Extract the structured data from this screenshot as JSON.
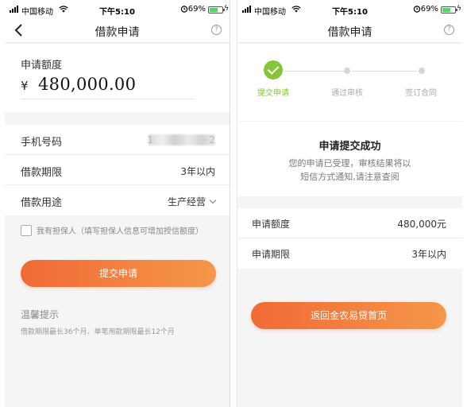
{
  "status": {
    "carrier": "中国移动",
    "time": "下午5:10",
    "battery": "69%",
    "battery_level": 0.69
  },
  "left": {
    "nav_title": "借款申请",
    "amount_label": "申请额度",
    "currency": "¥",
    "amount": "480,000.00",
    "phone_label": "手机号码",
    "phone_value": "1",
    "phone_tail": "2",
    "term_label": "借款期限",
    "term_value": "3年以内",
    "purpose_label": "借款用途",
    "purpose_value": "生产经营",
    "guarantor_text": "我有担保人（填写担保人信息可增加授信额度）",
    "submit_label": "提交申请",
    "tips_title": "温馨提示",
    "tips_text": "借款期限最长36个月、单笔用款期限最长12个月"
  },
  "right": {
    "nav_title": "借款申请",
    "steps": [
      {
        "label": "提交申请",
        "state": "done"
      },
      {
        "label": "通过审核",
        "state": "pending"
      },
      {
        "label": "签订合同",
        "state": "pending"
      }
    ],
    "success_title": "申请提交成功",
    "success_line1": "您的申请已受理，审核结果将以",
    "success_line2": "短信方式通知,请注意查阅",
    "amount_label": "申请额度",
    "amount_value": "480,000元",
    "term_label": "申请期限",
    "term_value": "3年以内",
    "home_label": "返回金农易贷首页"
  },
  "colors": {
    "accent_orange": "#f06a35",
    "accent_orange_end": "#f5974a",
    "success_green": "#86c43a",
    "background": "#f5f5f5"
  },
  "icons": {
    "back": "chevron-left-icon",
    "help": "question-circle-icon",
    "check": "check-circle-icon",
    "dropdown": "chevron-down-icon"
  }
}
